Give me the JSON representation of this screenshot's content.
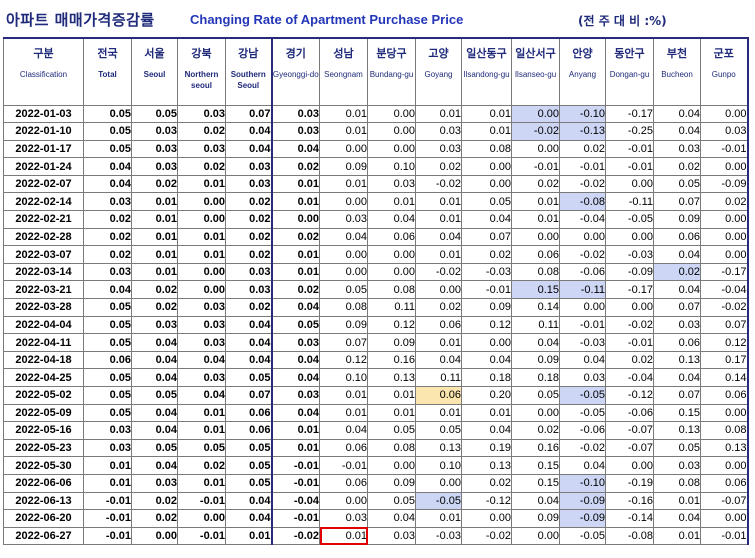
{
  "title": {
    "korean": "아파트 매매가격증감률",
    "english": "Changing Rate of Apartment Purchase Price",
    "note": "(전 주 대 비 :%)"
  },
  "columns": [
    {
      "kr": "구분",
      "en": "Classification"
    },
    {
      "kr": "전국",
      "en": "Total"
    },
    {
      "kr": "서울",
      "en": "Seoul"
    },
    {
      "kr": "강북",
      "en": "Northern seoul"
    },
    {
      "kr": "강남",
      "en": "Southern Seoul"
    },
    {
      "kr": "경기",
      "en": "Gyeonggi-do"
    },
    {
      "kr": "성남",
      "en": "Seongnam"
    },
    {
      "kr": "분당구",
      "en": "Bundang-gu"
    },
    {
      "kr": "고양",
      "en": "Goyang"
    },
    {
      "kr": "일산동구",
      "en": "Ilsandong-gu"
    },
    {
      "kr": "일산서구",
      "en": "Ilsanseo-gu"
    },
    {
      "kr": "안양",
      "en": "Anyang"
    },
    {
      "kr": "동안구",
      "en": "Dongan-gu"
    },
    {
      "kr": "부천",
      "en": "Bucheon"
    },
    {
      "kr": "군포",
      "en": "Gunpo"
    }
  ],
  "rows": [
    {
      "date": "2022-01-03",
      "v": [
        "0.05",
        "0.05",
        "0.03",
        "0.07",
        "0.03",
        "0.01",
        "0.00",
        "0.01",
        "0.01",
        "0.00",
        "-0.10",
        "-0.17",
        "0.04",
        "0.00"
      ]
    },
    {
      "date": "2022-01-10",
      "v": [
        "0.05",
        "0.03",
        "0.02",
        "0.04",
        "0.03",
        "0.01",
        "0.00",
        "0.03",
        "0.01",
        "-0.02",
        "-0.13",
        "-0.25",
        "0.04",
        "0.03"
      ]
    },
    {
      "date": "2022-01-17",
      "v": [
        "0.05",
        "0.03",
        "0.03",
        "0.04",
        "0.04",
        "0.00",
        "0.00",
        "0.03",
        "0.08",
        "0.00",
        "0.02",
        "-0.01",
        "0.03",
        "-0.01"
      ]
    },
    {
      "date": "2022-01-24",
      "v": [
        "0.04",
        "0.03",
        "0.02",
        "0.03",
        "0.02",
        "0.09",
        "0.10",
        "0.02",
        "0.00",
        "-0.01",
        "-0.01",
        "-0.01",
        "0.02",
        "0.00"
      ]
    },
    {
      "date": "2022-02-07",
      "v": [
        "0.04",
        "0.02",
        "0.01",
        "0.03",
        "0.01",
        "0.01",
        "0.03",
        "-0.02",
        "0.00",
        "0.02",
        "-0.02",
        "0.00",
        "0.05",
        "-0.09"
      ]
    },
    {
      "date": "2022-02-14",
      "v": [
        "0.03",
        "0.01",
        "0.00",
        "0.02",
        "0.01",
        "0.00",
        "0.01",
        "0.01",
        "0.05",
        "0.01",
        "-0.08",
        "-0.11",
        "0.07",
        "0.02"
      ]
    },
    {
      "date": "2022-02-21",
      "v": [
        "0.02",
        "0.01",
        "0.00",
        "0.02",
        "0.00",
        "0.03",
        "0.04",
        "0.01",
        "0.04",
        "0.01",
        "-0.04",
        "-0.05",
        "0.09",
        "0.00"
      ]
    },
    {
      "date": "2022-02-28",
      "v": [
        "0.02",
        "0.01",
        "0.01",
        "0.02",
        "0.02",
        "0.04",
        "0.06",
        "0.04",
        "0.07",
        "0.00",
        "0.00",
        "0.00",
        "0.06",
        "0.00"
      ]
    },
    {
      "date": "2022-03-07",
      "v": [
        "0.02",
        "0.01",
        "0.01",
        "0.02",
        "0.01",
        "0.00",
        "0.00",
        "0.01",
        "0.02",
        "0.06",
        "-0.02",
        "-0.03",
        "0.04",
        "0.00"
      ]
    },
    {
      "date": "2022-03-14",
      "v": [
        "0.03",
        "0.01",
        "0.00",
        "0.03",
        "0.01",
        "0.00",
        "0.00",
        "-0.02",
        "-0.03",
        "0.08",
        "-0.06",
        "-0.09",
        "0.02",
        "-0.17"
      ]
    },
    {
      "date": "2022-03-21",
      "v": [
        "0.04",
        "0.02",
        "0.00",
        "0.03",
        "0.02",
        "0.05",
        "0.08",
        "0.00",
        "-0.01",
        "0.15",
        "-0.11",
        "-0.17",
        "0.04",
        "-0.04"
      ]
    },
    {
      "date": "2022-03-28",
      "v": [
        "0.05",
        "0.02",
        "0.03",
        "0.02",
        "0.04",
        "0.08",
        "0.11",
        "0.02",
        "0.09",
        "0.14",
        "0.00",
        "0.00",
        "0.07",
        "-0.02"
      ]
    },
    {
      "date": "2022-04-04",
      "v": [
        "0.05",
        "0.03",
        "0.03",
        "0.04",
        "0.05",
        "0.09",
        "0.12",
        "0.06",
        "0.12",
        "0.11",
        "-0.01",
        "-0.02",
        "0.03",
        "0.07"
      ]
    },
    {
      "date": "2022-04-11",
      "v": [
        "0.05",
        "0.04",
        "0.03",
        "0.04",
        "0.03",
        "0.07",
        "0.09",
        "0.01",
        "0.00",
        "0.04",
        "-0.03",
        "-0.01",
        "0.06",
        "0.12"
      ]
    },
    {
      "date": "2022-04-18",
      "v": [
        "0.06",
        "0.04",
        "0.04",
        "0.04",
        "0.04",
        "0.12",
        "0.16",
        "0.04",
        "0.04",
        "0.09",
        "0.04",
        "0.02",
        "0.13",
        "0.17"
      ]
    },
    {
      "date": "2022-04-25",
      "v": [
        "0.05",
        "0.04",
        "0.03",
        "0.05",
        "0.04",
        "0.10",
        "0.13",
        "0.11",
        "0.18",
        "0.18",
        "0.03",
        "-0.04",
        "0.04",
        "0.14"
      ]
    },
    {
      "date": "2022-05-02",
      "v": [
        "0.05",
        "0.05",
        "0.04",
        "0.07",
        "0.03",
        "0.01",
        "0.01",
        "0.06",
        "0.20",
        "0.05",
        "-0.05",
        "-0.12",
        "0.07",
        "0.06"
      ]
    },
    {
      "date": "2022-05-09",
      "v": [
        "0.05",
        "0.04",
        "0.01",
        "0.06",
        "0.04",
        "0.01",
        "0.01",
        "0.01",
        "0.01",
        "0.00",
        "-0.05",
        "-0.06",
        "0.15",
        "0.00"
      ]
    },
    {
      "date": "2022-05-16",
      "v": [
        "0.03",
        "0.04",
        "0.01",
        "0.06",
        "0.01",
        "0.04",
        "0.05",
        "0.05",
        "0.04",
        "0.02",
        "-0.06",
        "-0.07",
        "0.13",
        "0.08"
      ]
    },
    {
      "date": "2022-05-23",
      "v": [
        "0.03",
        "0.05",
        "0.05",
        "0.05",
        "0.01",
        "0.06",
        "0.08",
        "0.13",
        "0.19",
        "0.16",
        "-0.02",
        "-0.07",
        "0.05",
        "0.13"
      ]
    },
    {
      "date": "2022-05-30",
      "v": [
        "0.01",
        "0.04",
        "0.02",
        "0.05",
        "-0.01",
        "-0.01",
        "0.00",
        "0.10",
        "0.13",
        "0.15",
        "0.04",
        "0.00",
        "0.03",
        "0.00"
      ]
    },
    {
      "date": "2022-06-06",
      "v": [
        "0.01",
        "0.03",
        "0.01",
        "0.05",
        "-0.01",
        "0.06",
        "0.09",
        "0.00",
        "0.02",
        "0.15",
        "-0.10",
        "-0.19",
        "0.08",
        "0.06"
      ]
    },
    {
      "date": "2022-06-13",
      "v": [
        "-0.01",
        "0.02",
        "-0.01",
        "0.04",
        "-0.04",
        "0.00",
        "0.05",
        "-0.05",
        "-0.12",
        "0.04",
        "-0.09",
        "-0.16",
        "0.01",
        "-0.07"
      ]
    },
    {
      "date": "2022-06-20",
      "v": [
        "-0.01",
        "0.02",
        "0.00",
        "0.04",
        "-0.01",
        "0.03",
        "0.04",
        "0.01",
        "0.00",
        "0.09",
        "-0.09",
        "-0.14",
        "0.04",
        "0.00"
      ]
    },
    {
      "date": "2022-06-27",
      "v": [
        "-0.01",
        "0.00",
        "-0.01",
        "0.01",
        "-0.02",
        "0.01",
        "0.03",
        "-0.03",
        "-0.02",
        "0.00",
        "-0.05",
        "-0.08",
        "0.01",
        "-0.01"
      ]
    }
  ],
  "highlights": {
    "blue": "#cdd6f4",
    "orange": "#fbe6b0",
    "red_outline": "#e00000",
    "header_text": "#1f2a7a"
  },
  "highlighted_cells": {
    "blue": [
      [
        0,
        10
      ],
      [
        0,
        11
      ],
      [
        1,
        10
      ],
      [
        1,
        11
      ],
      [
        5,
        11
      ],
      [
        9,
        13
      ],
      [
        10,
        10
      ],
      [
        10,
        11
      ],
      [
        16,
        11
      ],
      [
        21,
        11
      ],
      [
        22,
        8
      ],
      [
        22,
        11
      ],
      [
        23,
        11
      ]
    ],
    "orange": [
      [
        16,
        8
      ]
    ],
    "red": [
      [
        24,
        6
      ]
    ]
  }
}
